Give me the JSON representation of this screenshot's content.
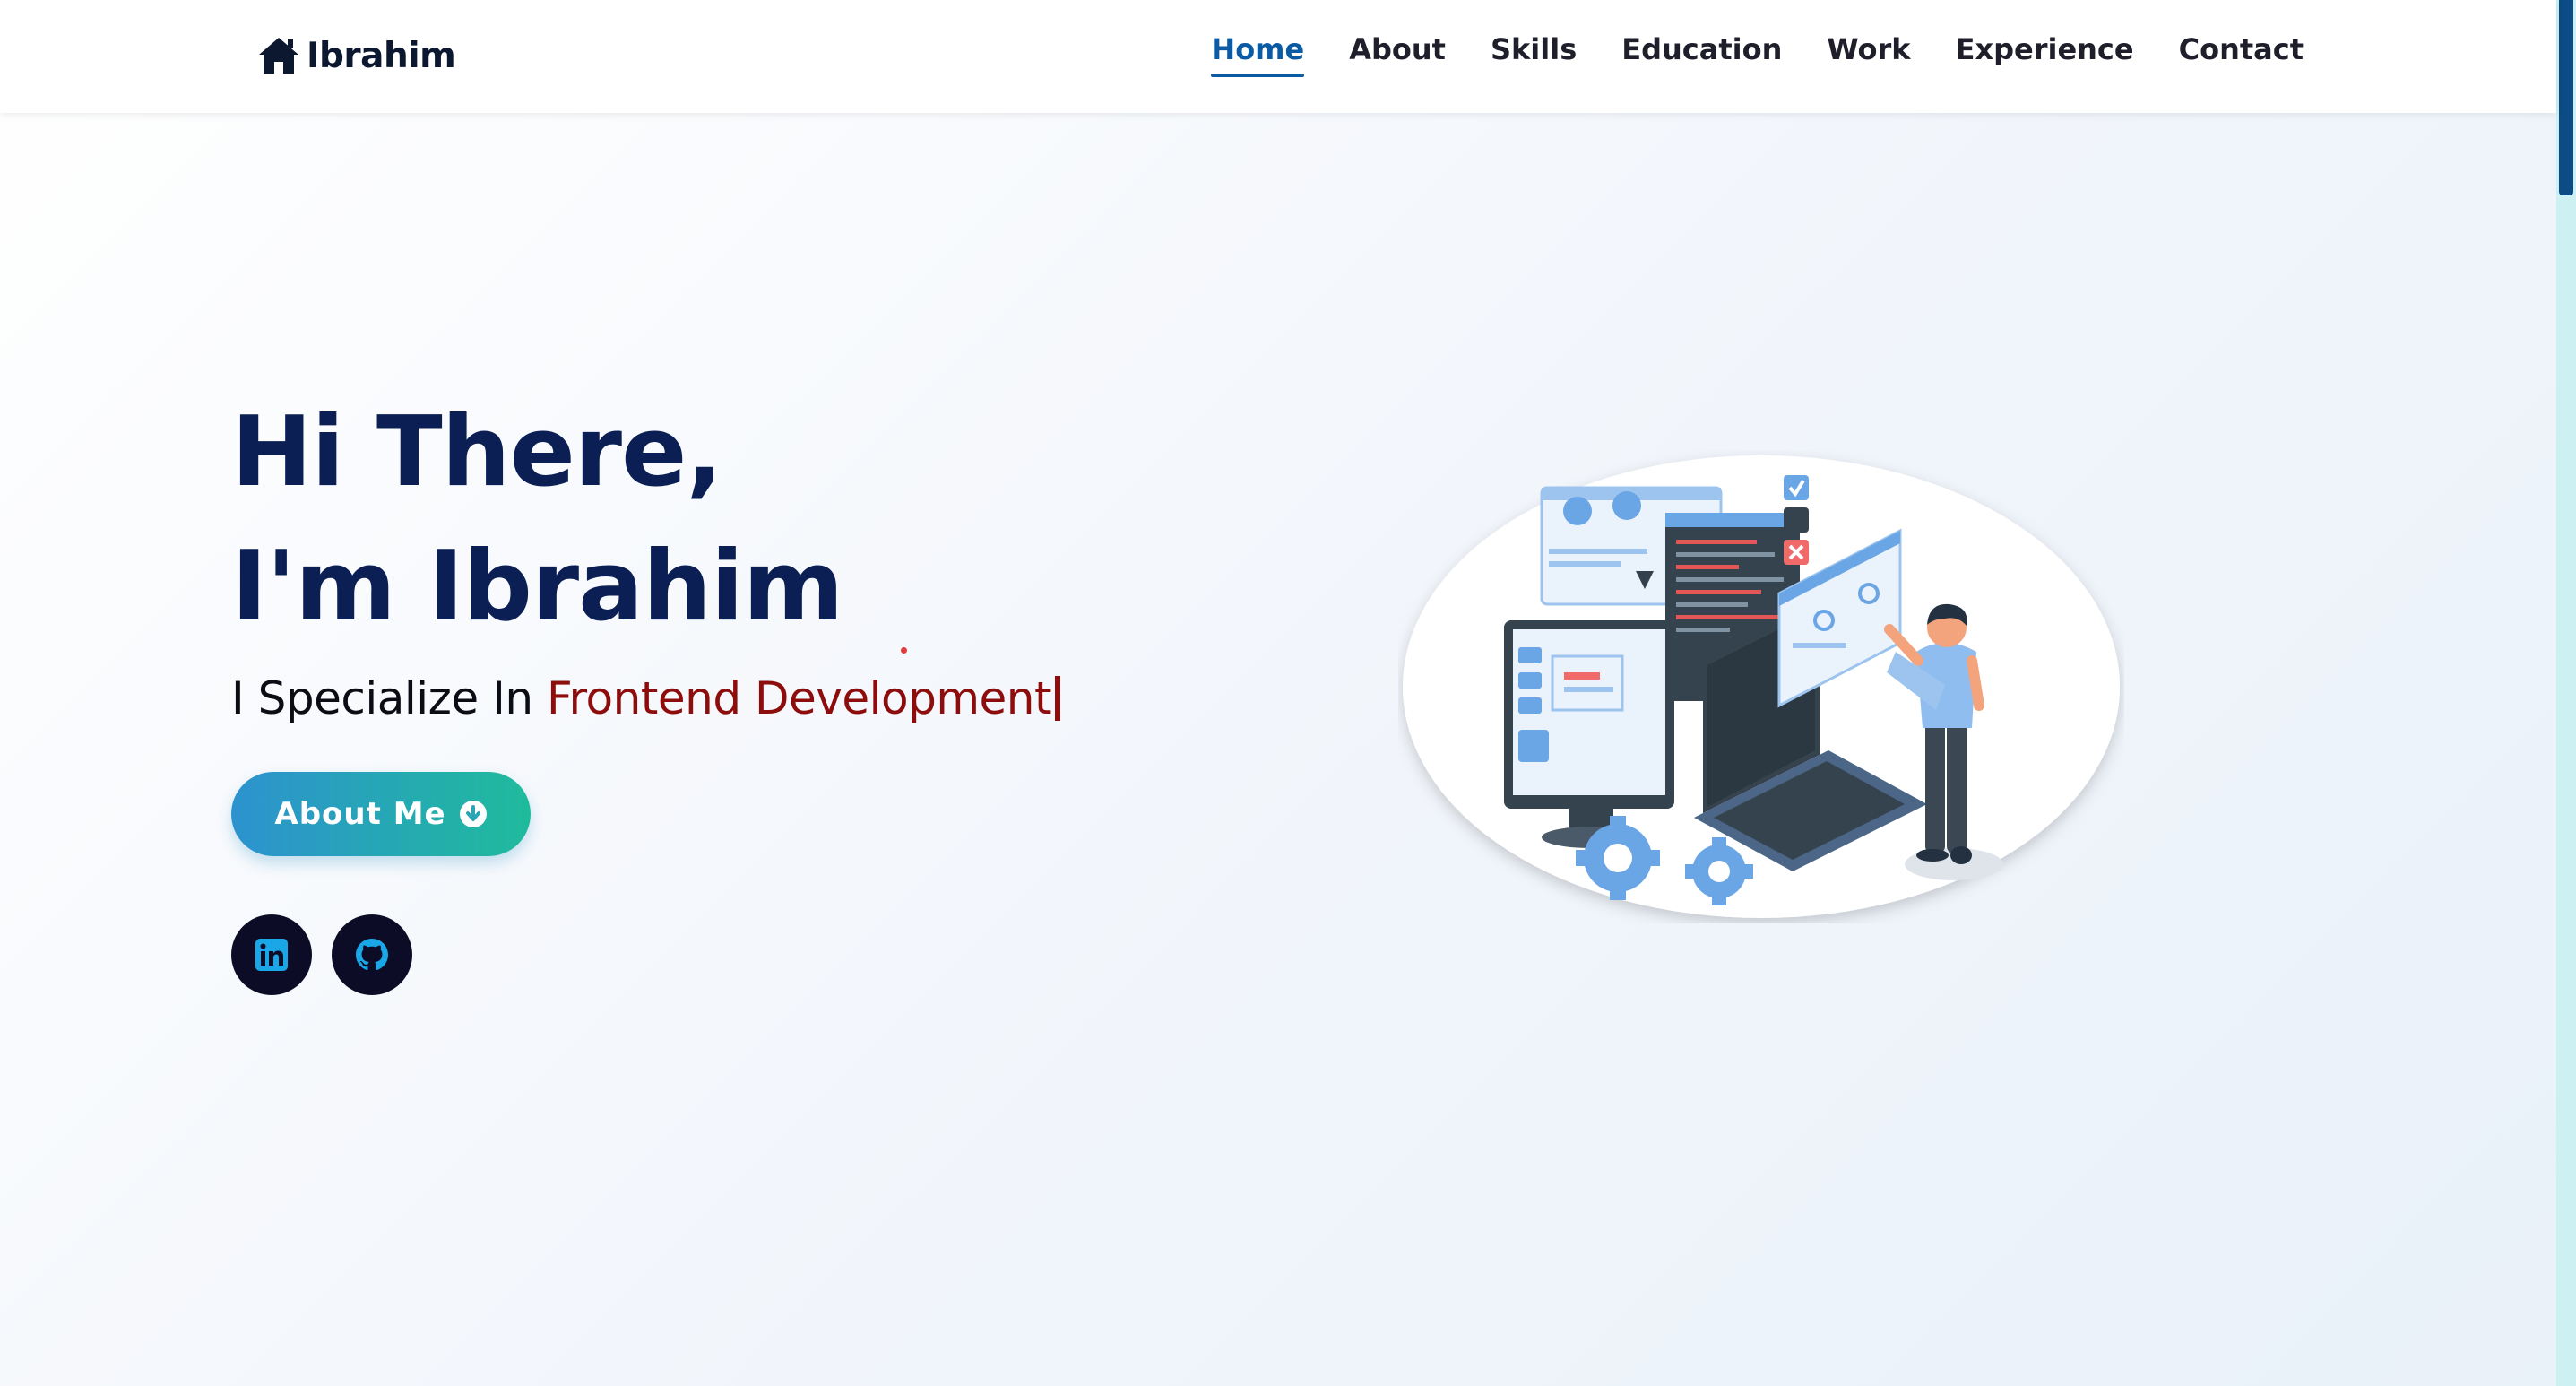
{
  "brand": {
    "name": "Ibrahim",
    "icon": "home-icon"
  },
  "nav": {
    "items": [
      {
        "label": "Home",
        "active": true
      },
      {
        "label": "About",
        "active": false
      },
      {
        "label": "Skills",
        "active": false
      },
      {
        "label": "Education",
        "active": false
      },
      {
        "label": "Work",
        "active": false
      },
      {
        "label": "Experience",
        "active": false
      },
      {
        "label": "Contact",
        "active": false
      }
    ]
  },
  "hero": {
    "greeting": "Hi There,",
    "intro": "I'm Ibrahim",
    "sub_prefix": "I Specialize In",
    "sub_role": "Frontend Development",
    "button_label": "About Me",
    "button_icon": "arrow-down-circle-icon"
  },
  "social": [
    {
      "name": "linkedin",
      "icon": "linkedin-icon"
    },
    {
      "name": "github",
      "icon": "github-icon"
    }
  ],
  "colors": {
    "title": "#0b1f54",
    "accent": "#0b5aa4",
    "role": "#8d0c0c",
    "button_start": "#2d92cf",
    "button_end": "#1fbb9c",
    "social_bg": "#0c0c27",
    "social_icon": "#1aa7e8"
  }
}
